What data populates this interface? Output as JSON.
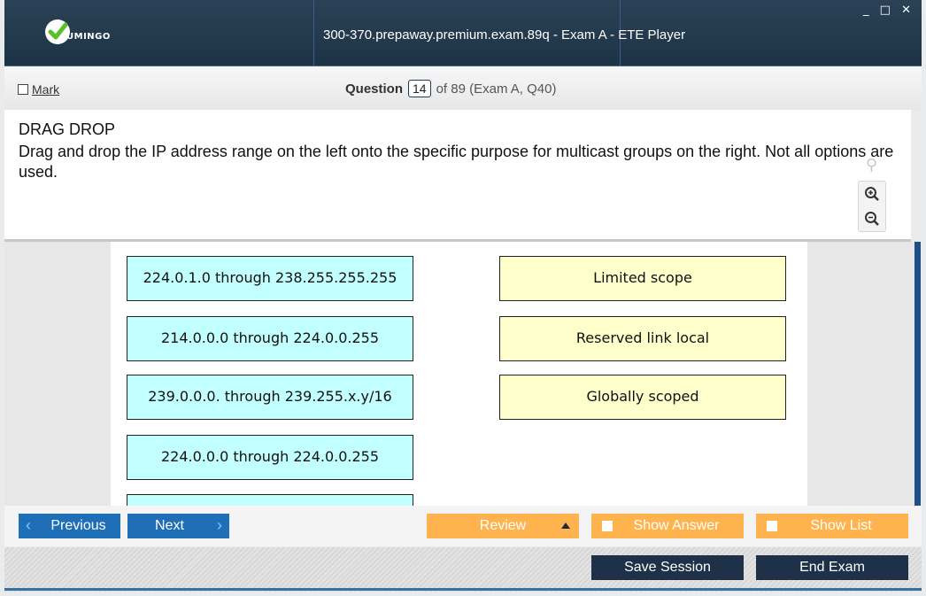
{
  "window": {
    "title": "300-370.prepaway.premium.exam.89q - Exam A - ETE Player",
    "logo_text": "UMINGO",
    "controls": "_ □ ✕"
  },
  "header": {
    "mark_label": "Mark",
    "question_label": "Question",
    "question_number": "14",
    "question_of": "of 89 (Exam A, Q40)"
  },
  "question": {
    "type_label": "DRAG DROP",
    "text": "Drag and drop the IP address range on the left onto the specific purpose for multicast groups on the right. Not all options are used."
  },
  "drag_items": [
    "224.0.1.0 through 238.255.255.255",
    "214.0.0.0 through 224.0.0.255",
    "239.0.0.0. through 239.255.x.y/16",
    "224.0.0.0 through 224.0.0.255",
    ""
  ],
  "drop_targets": [
    "Limited scope",
    "Reserved link local",
    "Globally scoped"
  ],
  "nav": {
    "previous": "Previous",
    "next": "Next",
    "review": "Review",
    "show_answer": "Show Answer",
    "show_list": "Show List"
  },
  "footer": {
    "save_session": "Save Session",
    "end_exam": "End Exam"
  },
  "colors": {
    "titlebar": "#243a4e",
    "source_item": "#c2ffff",
    "target_item": "#ffffcc",
    "nav_blue": "#1f6fb7",
    "nav_orange": "#ffb34f",
    "footer_dark": "#1e3148"
  }
}
